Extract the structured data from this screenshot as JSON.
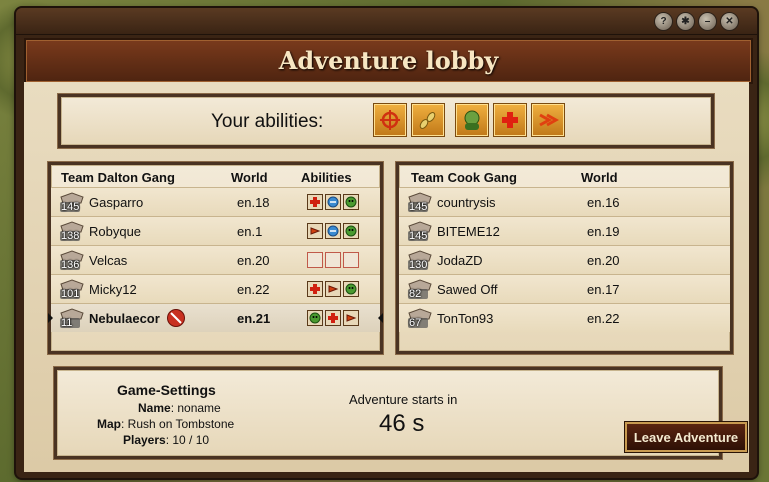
{
  "title": "Adventure lobby",
  "abilities": {
    "label": "Your abilities:",
    "slots": [
      "target-icon",
      "bullets-icon",
      "portrait-icon",
      "plus-icon",
      "arrows-icon"
    ]
  },
  "team_a": {
    "header": {
      "name": "Team Dalton Gang",
      "world": "World",
      "abilities": "Abilities"
    },
    "rows": [
      {
        "level": "145",
        "name": "Gasparro",
        "world": "en.18",
        "abilities": [
          "plus",
          "swap",
          "skull"
        ]
      },
      {
        "level": "138",
        "name": "Robyque",
        "world": "en.1",
        "abilities": [
          "dart",
          "swap",
          "skull"
        ]
      },
      {
        "level": "136",
        "name": "Velcas",
        "world": "en.20",
        "abilities": [
          "empty",
          "empty",
          "empty"
        ]
      },
      {
        "level": "101",
        "name": "Micky12",
        "world": "en.22",
        "abilities": [
          "plus",
          "dart",
          "skull"
        ]
      },
      {
        "level": "11",
        "name": "Nebulaecor",
        "world": "en.21",
        "abilities": [
          "skull",
          "plus",
          "dart"
        ],
        "selected": true
      }
    ]
  },
  "team_b": {
    "header": {
      "name": "Team Cook Gang",
      "world": "World"
    },
    "rows": [
      {
        "level": "145",
        "name": "countrysis",
        "world": "en.16"
      },
      {
        "level": "145",
        "name": "BITEME12",
        "world": "en.19"
      },
      {
        "level": "130",
        "name": "JodaZD",
        "world": "en.20"
      },
      {
        "level": "82",
        "name": "Sawed Off",
        "world": "en.17"
      },
      {
        "level": "67",
        "name": "TonTon93",
        "world": "en.22"
      }
    ]
  },
  "settings": {
    "title": "Game-Settings",
    "name_label": "Name",
    "name_value": ": noname",
    "map_label": "Map",
    "map_value": ": Rush on Tombstone",
    "players_label": "Players",
    "players_value": ": 10 / 10",
    "starts_label": "Adventure starts in",
    "countdown": "46 s",
    "leave_label": "Leave Adventure"
  }
}
